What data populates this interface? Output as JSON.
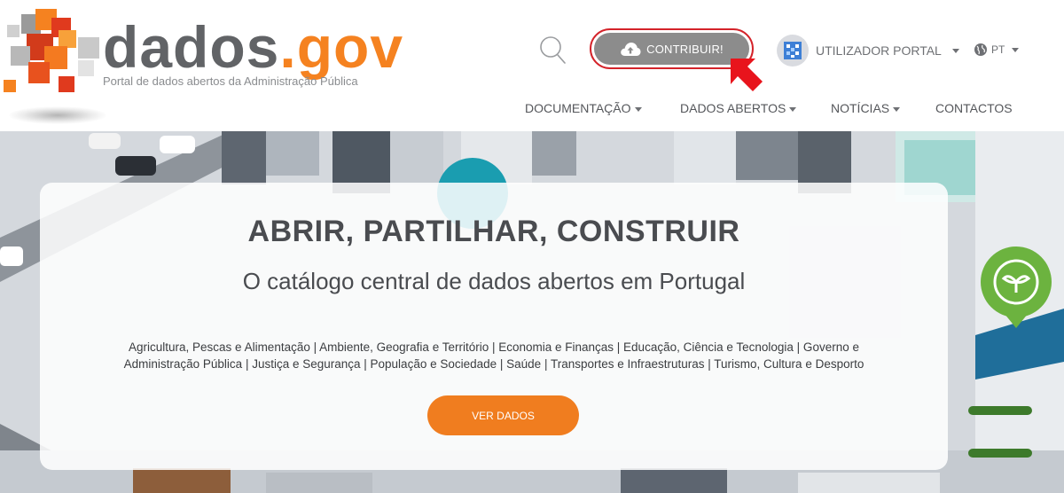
{
  "header": {
    "logo": {
      "word_main": "dados",
      "word_ext": ".gov",
      "tagline": "Portal de dados abertos da Administração Pública"
    },
    "search_icon": "search-icon",
    "contribute": {
      "label": "CONTRIBUIR!",
      "icon": "cloud-upload-icon"
    },
    "user_menu": {
      "label": "UTILIZADOR PORTAL",
      "icon": "avatar"
    },
    "lang_menu": {
      "label": "PT",
      "icon": "globe-icon"
    },
    "nav": {
      "documentation": "DOCUMENTAÇÃO",
      "open_data": "DADOS ABERTOS",
      "news": "NOTÍCIAS",
      "contacts": "CONTACTOS"
    }
  },
  "hero": {
    "title": "ABRIR, PARTILHAR, CONSTRUIR",
    "subtitle": "O catálogo central de dados abertos em Portugal",
    "themes_line1": "Agricultura, Pescas e Alimentação | Ambiente, Geografia e Território | Economia e Finanças | Educação, Ciência e Tecnologia | Governo e",
    "themes_line2": "Administração Pública | Justiça e Segurança | População e Sociedade | Saúde | Transportes e Infraestruturas | Turismo, Cultura e Desporto",
    "cta_label": "VER DADOS"
  },
  "colors": {
    "brand_orange": "#f58220",
    "logo_grey": "#616366",
    "cta_orange": "#f07d1f",
    "contribute_border": "#d4232a",
    "contribute_fill": "#8c8c8c",
    "annotation_arrow": "#e8141c",
    "pin_green": "#6cb33f",
    "pin_teal": "#1a9db0"
  }
}
